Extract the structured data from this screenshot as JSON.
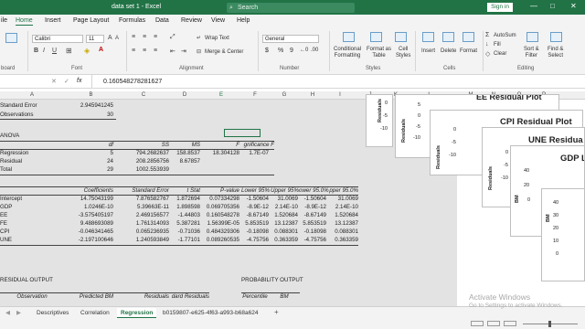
{
  "titlebar": {
    "doc_title": "data set 1  -  Excel",
    "search_placeholder": "Search",
    "sign_in": "Sign in",
    "minimize": "—",
    "restore": "□",
    "close": "✕"
  },
  "ribbon_tabs": [
    "ile",
    "Home",
    "Insert",
    "Page Layout",
    "Formulas",
    "Data",
    "Review",
    "View",
    "Help"
  ],
  "ribbon": {
    "clipboard_label": "board",
    "font_name": "Calibri",
    "font_size": "11",
    "font_label": "Font",
    "bold": "B",
    "italic": "I",
    "underline": "U",
    "grow": "A",
    "shrink": "A",
    "alignment_label": "Alignment",
    "wrap_text": "Wrap Text",
    "merge_center": "Merge & Center",
    "number_label": "Number",
    "number_format": "General",
    "currency": "$",
    "percent": "%",
    "comma": "9",
    "styles_label": "Styles",
    "conditional_formatting": "Conditional\nFormatting",
    "format_as_table": "Format as\nTable",
    "cell_styles": "Cell\nStyles",
    "cells_label": "Cells",
    "insert": "Insert",
    "delete": "Delete",
    "format": "Format",
    "editing_label": "Editing",
    "autosum": "AutoSum",
    "fill": "Fill",
    "clear": "Clear",
    "sort_filter": "Sort &\nFilter",
    "find_select": "Find &\nSelect"
  },
  "formula_bar": {
    "value": "0.160548278281627",
    "fx": "fx"
  },
  "columns": [
    "A",
    "B",
    "C",
    "D",
    "E",
    "F",
    "G",
    "H",
    "I",
    "J",
    "K",
    "L",
    "M",
    "N",
    "O",
    "P"
  ],
  "sheet": {
    "std_error_label": "Standard Error",
    "std_error_value": "2.945941245",
    "observations_label": "Observations",
    "observations_value": "30",
    "anova_label": "ANOVA",
    "anova_headers": [
      "df",
      "SS",
      "MS",
      "F",
      "gnificance F"
    ],
    "anova_rows": [
      {
        "label": "Regression",
        "df": "5",
        "ss": "794.2682637",
        "ms": "158.8537",
        "f": "18.304128",
        "sig": "1.7E-07"
      },
      {
        "label": "Residual",
        "df": "24",
        "ss": "208.2856756",
        "ms": "8.67857",
        "f": "",
        "sig": ""
      },
      {
        "label": "Total",
        "df": "29",
        "ss": "1002.553939",
        "ms": "",
        "f": "",
        "sig": ""
      }
    ],
    "coef_headers": [
      "Coefficients",
      "Standard Error",
      "t Stat",
      "P-value",
      "Lower 95%",
      "Upper 95%",
      "ower 95.0%",
      "pper 95.0%"
    ],
    "coef_rows": [
      {
        "label": "Intercept",
        "vals": [
          "14.75043199",
          "7.876582767",
          "1.872694",
          "0.07334298",
          "-1.50604",
          "31.0069",
          "-1.50604",
          "31.0069"
        ]
      },
      {
        "label": "GDP",
        "vals": [
          "1.0246E-10",
          "5.39663E-11",
          "1.898598",
          "0.069705356",
          "-8.9E-12",
          "2.14E-10",
          "-8.9E-12",
          "2.14E-10"
        ]
      },
      {
        "label": "EE",
        "vals": [
          "-3.575405197",
          "2.469156577",
          "-1.44803",
          "0.160548278",
          "-8.67149",
          "1.520684",
          "-8.67149",
          "1.520684"
        ]
      },
      {
        "label": "FE",
        "vals": [
          "9.488693089",
          "1.761314093",
          "5.387281",
          "1.56399E-05",
          "5.853519",
          "13.12387",
          "5.853519",
          "13.12387"
        ]
      },
      {
        "label": "CPI",
        "vals": [
          "-0.046341465",
          "0.065236935",
          "-0.71036",
          "0.484329306",
          "-0.18098",
          "0.088301",
          "-0.18098",
          "0.088301"
        ]
      },
      {
        "label": "UNE",
        "vals": [
          "-2.197100646",
          "1.240593849",
          "-1.77101",
          "0.089260535",
          "-4.75756",
          "0.363359",
          "-4.75756",
          "0.363359"
        ]
      }
    ],
    "residual_output": "RESIDUAL OUTPUT",
    "probability_output": "PROBABILITY OUTPUT",
    "resid_headers": [
      "Observation",
      "Predicted BM",
      "Residuals",
      "dard Residuals"
    ],
    "prob_headers": [
      "Percentile",
      "BM"
    ]
  },
  "charts": [
    {
      "title": "EE  Residual Plot",
      "ylabel": "Residuals",
      "ticks": [
        "5",
        "0",
        "-5",
        "-10"
      ]
    },
    {
      "title": "CPI  Residual Plot",
      "ylabel": "Residuals",
      "ticks": [
        "0",
        "-5",
        "-10"
      ]
    },
    {
      "title": "UNE  Residua",
      "ylabel": "Residuals",
      "ticks": [
        "0",
        "-5",
        "-10"
      ]
    },
    {
      "title": "GDP L",
      "ylabel": "BM",
      "ticks": [
        "40",
        "20",
        "0"
      ]
    },
    {
      "title": "",
      "ylabel": "BM",
      "ticks": [
        "40",
        "30",
        "20",
        "10",
        "0"
      ]
    }
  ],
  "left_chart_ticks": [
    "0",
    "-5",
    "-10"
  ],
  "left_chart_ylabel": "Residuals",
  "sheet_tabs": [
    "Descriptives",
    "Correlation",
    "Regression",
    "b0159807-e625-4f63-a993-b68a624"
  ],
  "active_tab": "Regression",
  "status": {
    "add_sheet": "+",
    "zoom": ""
  },
  "watermark": {
    "line1": "Activate Windows",
    "line2": "Go to Settings to activate Windows."
  },
  "colors": {
    "accent": "#217346",
    "selection": "#217346"
  }
}
